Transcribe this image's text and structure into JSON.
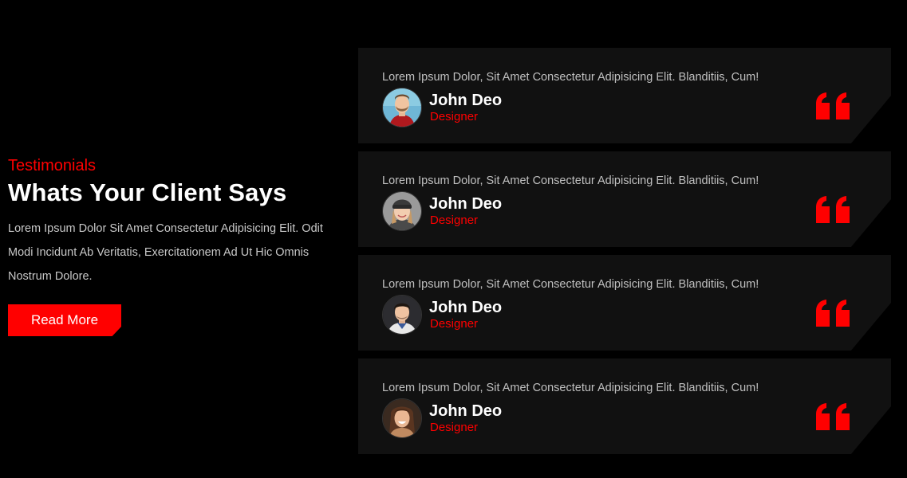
{
  "intro": {
    "eyebrow": "Testimonials",
    "heading": "Whats Your Client Says",
    "text": "Lorem Ipsum Dolor Sit Amet Consectetur Adipisicing Elit. Odit Modi Incidunt Ab Veritatis, Exercitationem Ad Ut Hic Omnis Nostrum Dolore.",
    "button_label": "Read More"
  },
  "colors": {
    "accent": "#ff0000",
    "background": "#000000",
    "card": "#111111"
  },
  "testimonials": [
    {
      "quote": "Lorem Ipsum Dolor, Sit Amet Consectetur Adipisicing Elit. Blanditiis, Cum!",
      "name": "John Deo",
      "role": "Designer",
      "avatar": "man-with-beard-avatar"
    },
    {
      "quote": "Lorem Ipsum Dolor, Sit Amet Consectetur Adipisicing Elit. Blanditiis, Cum!",
      "name": "John Deo",
      "role": "Designer",
      "avatar": "woman-in-beanie-avatar"
    },
    {
      "quote": "Lorem Ipsum Dolor, Sit Amet Consectetur Adipisicing Elit. Blanditiis, Cum!",
      "name": "John Deo",
      "role": "Designer",
      "avatar": "man-dark-hair-avatar"
    },
    {
      "quote": "Lorem Ipsum Dolor, Sit Amet Consectetur Adipisicing Elit. Blanditiis, Cum!",
      "name": "John Deo",
      "role": "Designer",
      "avatar": "woman-smiling-avatar"
    }
  ]
}
